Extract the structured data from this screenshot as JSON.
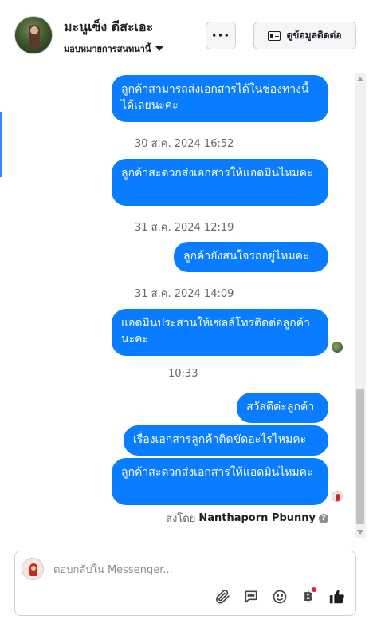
{
  "header": {
    "contact_name": "มะนูเซ็ง ดีสะเอะ",
    "assign_label": "มอบหมายการสนทนานี้",
    "more_label": "···",
    "view_contact_label": "ดูข้อมูลติดต่อ"
  },
  "messages": [
    {
      "type": "bubble",
      "text": "ลูกค้าสามารถส่งเอกสารได้ในช่องทางนี้ได้เลยนะคะ"
    },
    {
      "type": "timestamp",
      "text": "30 ส.ค. 2024 16:52"
    },
    {
      "type": "bubble",
      "text": "ลูกค้าสะดวกส่งเอกสารให้แอดมินไหมคะ"
    },
    {
      "type": "timestamp",
      "text": "31 ส.ค. 2024 12:19"
    },
    {
      "type": "bubble",
      "text": "ลูกค้ายังสนใจรถอยู่ไหมคะ"
    },
    {
      "type": "timestamp",
      "text": "31 ส.ค. 2024 14:09"
    },
    {
      "type": "bubble",
      "text": "แอดมินประสานให้เซลล์โทรติดต่อลูกค้านะคะ"
    },
    {
      "type": "timestamp",
      "text": "10:33"
    },
    {
      "type": "bubble",
      "text": "สวัสดีค่ะลูกค้า"
    },
    {
      "type": "bubble",
      "text": "เรื่องเอกสารลูกค้าติดขัดอะไรไหมคะ"
    },
    {
      "type": "bubble",
      "text": "ลูกค้าสะดวกส่งเอกสารให้แอดมินไหมคะ"
    }
  ],
  "sent_by": {
    "prefix": "ส่งโดย",
    "name": "Nanthaporn Pbunny",
    "help": "?"
  },
  "composer": {
    "placeholder": "ตอบกลับใน Messenger...",
    "baht_symbol": "฿"
  },
  "colors": {
    "bubble": "#0a7cff",
    "timestamp": "#65676b",
    "accent": "#2e89ff"
  }
}
